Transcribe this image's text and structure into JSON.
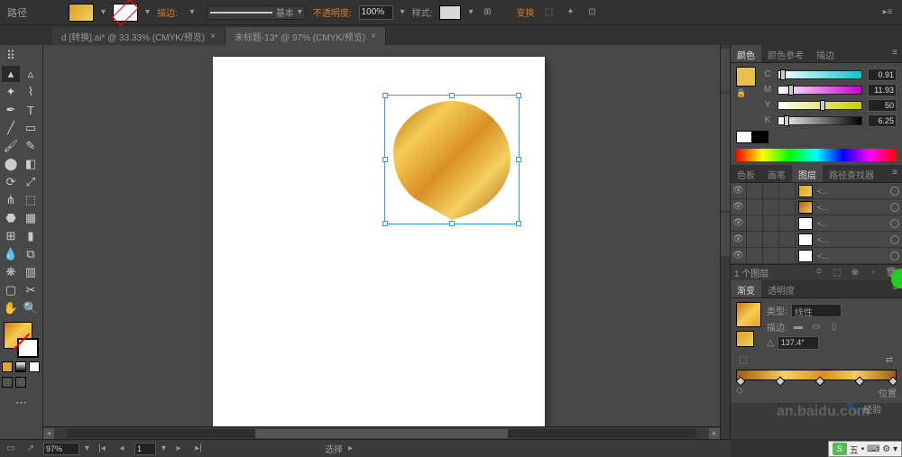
{
  "topbar": {
    "path_label": "路径",
    "stroke_label": "描边:",
    "stroke_style": "基本",
    "opacity_label": "不透明度:",
    "opacity_value": "100%",
    "style_label": "样式:",
    "transform_label": "变换"
  },
  "tabs": [
    {
      "label": "d [转换].ai* @ 33.33% (CMYK/预览)",
      "active": false
    },
    {
      "label": "未标题-13* @ 97% (CMYK/预览)",
      "active": true
    }
  ],
  "color_panel": {
    "tabs": [
      "颜色",
      "颜色参考",
      "描边"
    ],
    "channels": [
      {
        "ch": "C",
        "val": "0.91",
        "pos": 2
      },
      {
        "ch": "M",
        "val": "11.93",
        "pos": 12
      },
      {
        "ch": "Y",
        "val": "50",
        "pos": 50
      },
      {
        "ch": "K",
        "val": "6.25",
        "pos": 7
      }
    ]
  },
  "layers_panel": {
    "tabs": [
      "色板",
      "画笔",
      "图层",
      "路径查找器"
    ],
    "rows": [
      {
        "thumb": "gold",
        "name": "<..."
      },
      {
        "thumb": "gold2",
        "name": "<..."
      },
      {
        "thumb": "white",
        "name": "<..."
      },
      {
        "thumb": "white",
        "name": "<..."
      },
      {
        "thumb": "white",
        "name": "<..."
      }
    ],
    "footer": "1 个图层"
  },
  "gradient_panel": {
    "tabs": [
      "渐变",
      "透明度"
    ],
    "type_label": "类型:",
    "type_value": "线性",
    "stroke_label": "描边:",
    "angle_value": "137.4°",
    "ratio_label": "位置"
  },
  "statusbar": {
    "zoom": "97%",
    "page": "1",
    "mode": "选择"
  },
  "watermark": {
    "text": "经验",
    "url": "an.baidu.com"
  },
  "ime": {
    "label": "五"
  }
}
